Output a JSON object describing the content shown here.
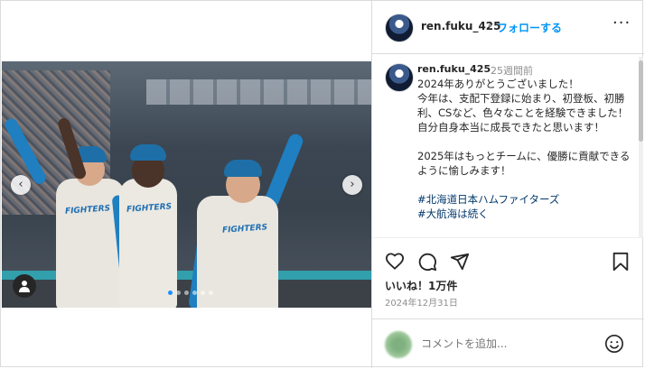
{
  "header": {
    "username": "ren.fuku_425",
    "separator": "•",
    "follow_label": "フォローする",
    "more_label": "···"
  },
  "media": {
    "jersey_text": "FIGHTERS",
    "prev_icon": "chevron-left-icon",
    "next_icon": "chevron-right-icon",
    "prev_glyph": "‹",
    "next_glyph": "›",
    "carousel_total": 6,
    "carousel_active_index": 0
  },
  "caption": {
    "username": "ren.fuku_425",
    "time_ago": "25週間前",
    "lines_1": "2024年ありがとうございました！\n今年は、支配下登録に始まり、初登板、初勝利、CSなど、色々なことを経験できました！自分自身本当に成長できたと思います！\n\n2025年はもっとチームに、優勝に貢献できるように愉しみます！\n\n",
    "tag_1": "#北海道日本ハムファイターズ",
    "tag_2": "#大航海は続く"
  },
  "actions": {
    "likes": "いいね！1万件",
    "date": "2024年12月31日",
    "icons": [
      "heart-icon",
      "comment-icon",
      "share-icon",
      "bookmark-icon"
    ]
  },
  "add_comment": {
    "placeholder": "コメントを追加...",
    "emoji_icon": "smiley-icon"
  },
  "colors": {
    "accent": "#0095f6",
    "tag": "#00376b",
    "text": "#262626",
    "muted": "#8e8e8e"
  }
}
